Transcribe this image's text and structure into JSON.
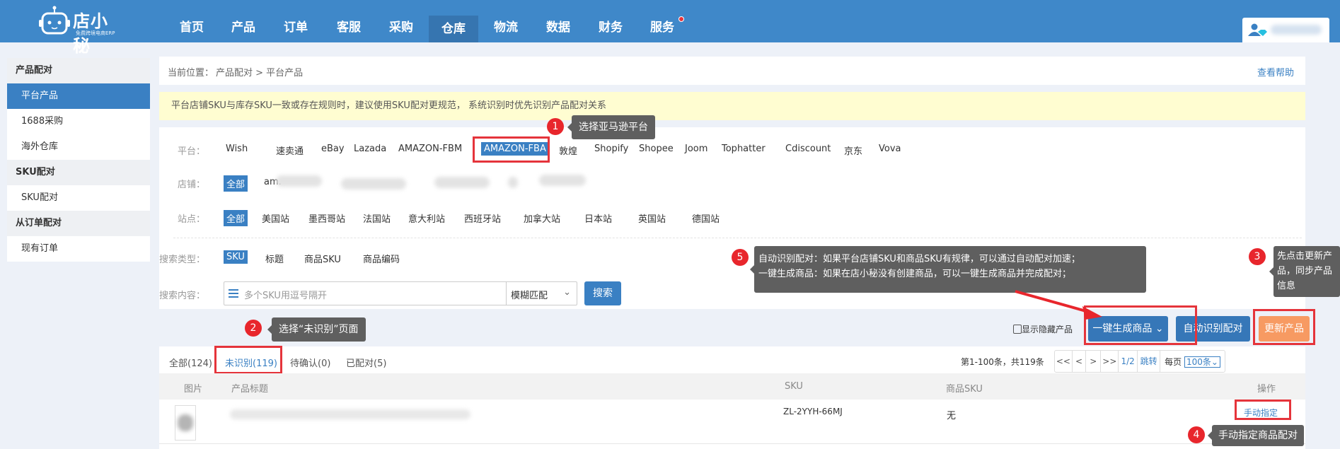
{
  "header": {
    "logo_name": "店小秘",
    "logo_sub": "免费跨境电商ERP",
    "nav": [
      "首页",
      "产品",
      "订单",
      "客服",
      "采购",
      "仓库",
      "物流",
      "数据",
      "财务",
      "服务"
    ],
    "active_nav": "仓库"
  },
  "sidebar": {
    "groups": [
      {
        "title": "产品配对",
        "items": [
          "平台产品",
          "1688采购",
          "海外仓库"
        ]
      },
      {
        "title": "SKU配对",
        "items": [
          "SKU配对"
        ]
      },
      {
        "title": "从订单配对",
        "items": [
          "现有订单"
        ]
      }
    ],
    "selected": "平台产品"
  },
  "breadcrumb": {
    "prefix": "当前位置：",
    "path": "产品配对 > 平台产品",
    "help": "查看帮助"
  },
  "notice": "平台店铺SKU与库存SKU一致或存在规则时，建议使用SKU配对更规范， 系统识别时优先识别产品配对关系",
  "filters": {
    "platform_label": "平台：",
    "platforms": [
      "Wish",
      "速卖通",
      "eBay",
      "Lazada",
      "AMAZON-FBM",
      "AMAZON-FBA",
      "敦煌",
      "Shopify",
      "Shopee",
      "Joom",
      "Tophatter",
      "Cdiscount",
      "京东",
      "Vova"
    ],
    "platform_selected": "AMAZON-FBA",
    "store_label": "店铺：",
    "store_all": "全部",
    "store_first": "am.",
    "site_label": "站点：",
    "site_all": "全部",
    "sites": [
      "美国站",
      "墨西哥站",
      "法国站",
      "意大利站",
      "西班牙站",
      "加拿大站",
      "日本站",
      "英国站",
      "德国站"
    ],
    "search_type_label": "搜索类型：",
    "search_types": [
      "SKU",
      "标题",
      "商品SKU",
      "商品编码"
    ],
    "search_content_label": "搜索内容：",
    "search_placeholder": "多个SKU用逗号隔开",
    "match_mode": "模糊匹配",
    "search_button": "搜索"
  },
  "actions": {
    "show_hidden": "显示隐藏产品",
    "generate": "一键生成商品",
    "auto_match": "自动识别配对",
    "update": "更新产品"
  },
  "tabs": [
    "全部(124)",
    "未识别(119)",
    "待确认(0)",
    "已配对(5)"
  ],
  "active_tab": "未识别(119)",
  "pagination": {
    "summary": "第1-100条，共119条",
    "first": "<<",
    "prev": "<",
    "next": ">",
    "last": ">>",
    "page": "1/2",
    "jump": "跳转",
    "per_page_label": "每页",
    "per_page": "100条"
  },
  "table": {
    "columns": [
      "图片",
      "产品标题",
      "SKU",
      "商品SKU",
      "操作"
    ],
    "rows": [
      {
        "sku": "ZL-2YYH-66MJ",
        "product_sku": "无",
        "action": "手动指定"
      }
    ]
  },
  "annotations": [
    {
      "n": "1",
      "text": "选择亚马逊平台"
    },
    {
      "n": "2",
      "text": "选择“未识别”页面"
    },
    {
      "n": "3",
      "text": "先点击更新产品，同步产品信息"
    },
    {
      "n": "4",
      "text": "手动指定商品配对"
    },
    {
      "n": "5",
      "line1": "自动识别配对：如果平台店铺SKU和商品SKU有规律，可以通过自动配对加速；",
      "line2": "一键生成商品：如果在店小秘没有创建商品，可以一键生成商品并完成配对；"
    }
  ]
}
